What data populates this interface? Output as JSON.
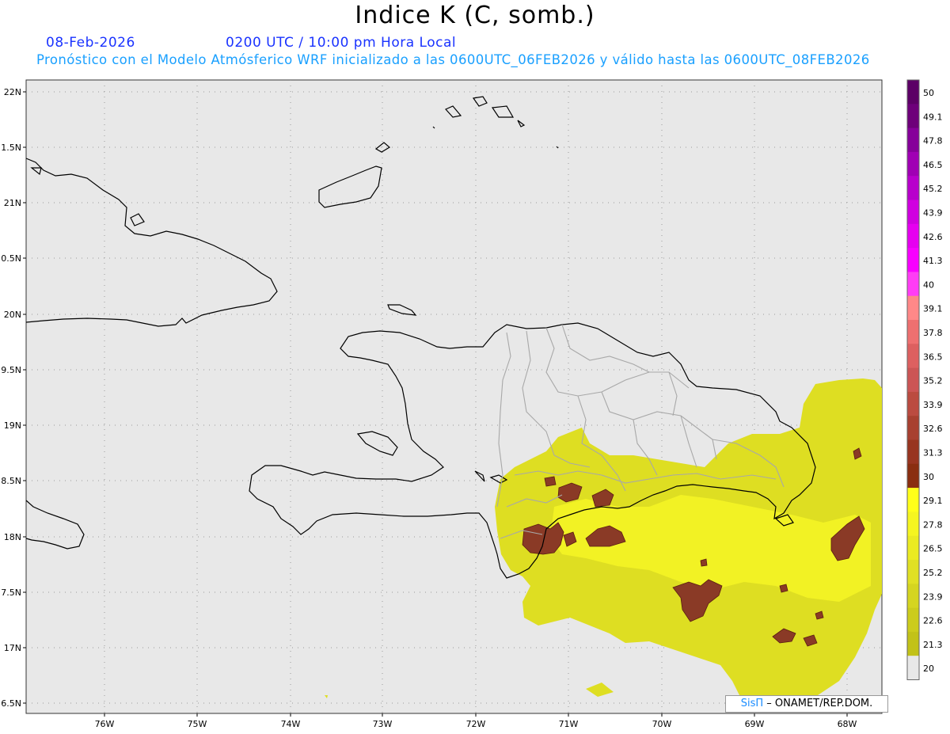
{
  "header": {
    "title": "Indice K (C, somb.)",
    "date": "08-Feb-2026",
    "time": "0200 UTC / 10:00 pm Hora Local",
    "forecast": "Pronóstico con el Modelo Atmósferico WRF inicializado a las 0600UTC_06FEB2026 y válido hasta las  0600UTC_08FEB2026"
  },
  "map": {
    "lat_labels": [
      "22N",
      "1.5N",
      "21N",
      "0.5N",
      "20N",
      "9.5N",
      "19N",
      "8.5N",
      "18N",
      "7.5N",
      "17N",
      "6.5N"
    ],
    "lon_labels": [
      "76W",
      "75W",
      "74W",
      "73W",
      "72W",
      "71W",
      "70W",
      "69W",
      "68W"
    ],
    "background_color": "#e8e8e8",
    "coast_color": "#000000",
    "province_color": "#a8a8a8"
  },
  "colorbar": {
    "labels": [
      "50",
      "49.1",
      "47.8",
      "46.5",
      "45.2",
      "43.9",
      "42.6",
      "41.3",
      "40",
      "39.1",
      "37.8",
      "36.5",
      "35.2",
      "33.9",
      "32.6",
      "31.3",
      "30",
      "29.1",
      "27.8",
      "26.5",
      "25.2",
      "23.9",
      "22.6",
      "21.3",
      "20"
    ],
    "colors": [
      "#5c0066",
      "#6e007a",
      "#86009a",
      "#a000b4",
      "#b800cc",
      "#d000e0",
      "#e600f0",
      "#f800ff",
      "#ff3df5",
      "#ff8888",
      "#ee7070",
      "#dd6060",
      "#cc5555",
      "#bb4b40",
      "#a84030",
      "#983520",
      "#8a2e10",
      "#ffff1a",
      "#f5f520",
      "#ebeb22",
      "#e0e024",
      "#d5d520",
      "#cccc1c",
      "#c2c218",
      "#e8e8e8"
    ]
  },
  "credit": {
    "sis": "SisΠ",
    "rest": "– ONAMET/REP.DOM."
  }
}
